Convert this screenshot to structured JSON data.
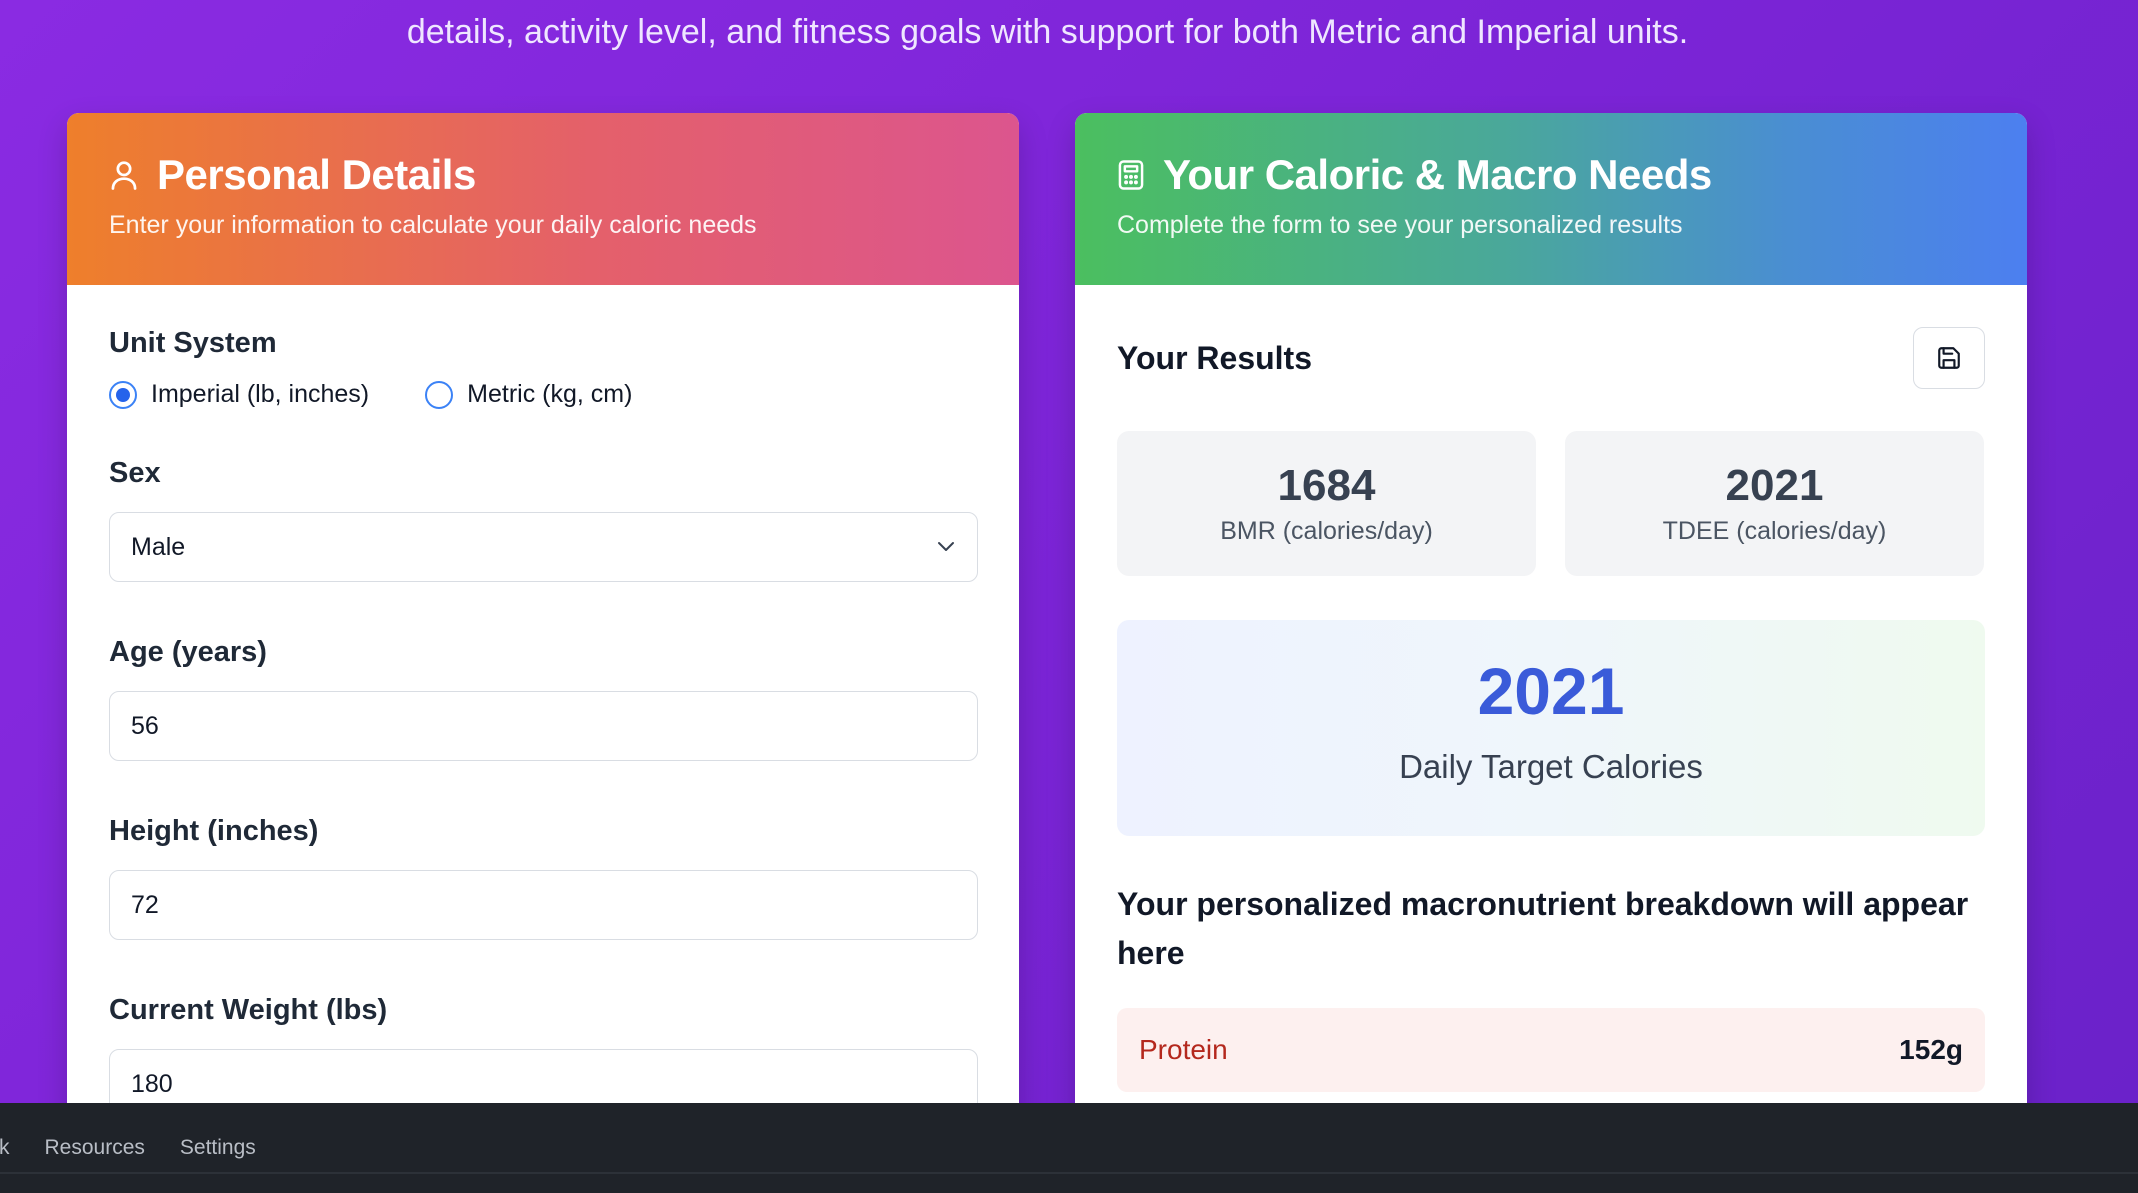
{
  "intro": {
    "text": "details, activity level, and fitness goals with support for both Metric and Imperial units."
  },
  "personal": {
    "title": "Personal Details",
    "subtitle": "Enter your information to calculate your daily caloric needs",
    "unit_system": {
      "label": "Unit System",
      "options": [
        "Imperial (lb, inches)",
        "Metric (kg, cm)"
      ],
      "selected": "Imperial (lb, inches)"
    },
    "sex": {
      "label": "Sex",
      "value": "Male"
    },
    "age": {
      "label": "Age (years)",
      "value": "56"
    },
    "height": {
      "label": "Height (inches)",
      "value": "72"
    },
    "weight": {
      "label": "Current Weight (lbs)",
      "value": "180"
    }
  },
  "results": {
    "title": "Your Caloric & Macro Needs",
    "subtitle": "Complete the form to see your personalized results",
    "section_title": "Your Results",
    "bmr": {
      "value": "1684",
      "label": "BMR (calories/day)"
    },
    "tdee": {
      "value": "2021",
      "label": "TDEE (calories/day)"
    },
    "target": {
      "value": "2021",
      "label": "Daily Target Calories"
    },
    "macro_heading": "Your personalized macronutrient breakdown will appear here",
    "macros": [
      {
        "name": "Protein",
        "value": "152g"
      }
    ]
  },
  "taskbar": {
    "items": [
      "rk",
      "Resources",
      "Settings"
    ]
  },
  "colors": {
    "background": "#7b24d6",
    "personal_header_start": "#ee7f2b",
    "personal_header_end": "#dc558e",
    "results_header_start": "#4bbf5f",
    "results_header_end": "#4c7ff0",
    "target_value": "#3a5bd9",
    "protein_text": "#b4281d"
  },
  "icons": {
    "personal": "user-icon",
    "results": "calculator-icon",
    "save": "save-icon",
    "select": "chevron-down-icon"
  }
}
